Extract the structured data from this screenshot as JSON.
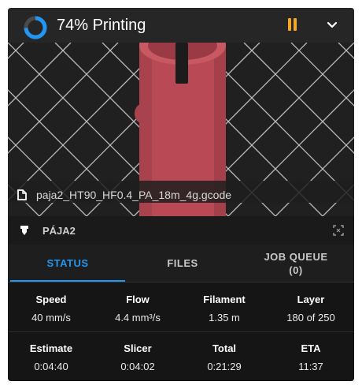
{
  "header": {
    "title": "74% Printing",
    "progress_percent": 74,
    "accent_color": "#2196f3",
    "pause_color": "#f5a623",
    "icons": [
      "progress-ring",
      "pause-icon",
      "chevron-down-icon"
    ]
  },
  "preview": {
    "file_name": "paja2_HT90_HF0.4_PA_18m_4g.gcode",
    "model_color": "#b94a55"
  },
  "printer": {
    "name": "PÁJA2"
  },
  "tabs": [
    {
      "label": "STATUS",
      "active": true
    },
    {
      "label": "FILES",
      "active": false
    },
    {
      "label": "JOB QUEUE\n(0)",
      "active": false
    }
  ],
  "stats": [
    {
      "label": "Speed",
      "value": "40 mm/s"
    },
    {
      "label": "Flow",
      "value": "4.4 mm³/s"
    },
    {
      "label": "Filament",
      "value": "1.35 m"
    },
    {
      "label": "Layer",
      "value": "180 of 250"
    },
    {
      "label": "Estimate",
      "value": "0:04:40"
    },
    {
      "label": "Slicer",
      "value": "0:04:02"
    },
    {
      "label": "Total",
      "value": "0:21:29"
    },
    {
      "label": "ETA",
      "value": "11:37"
    }
  ]
}
